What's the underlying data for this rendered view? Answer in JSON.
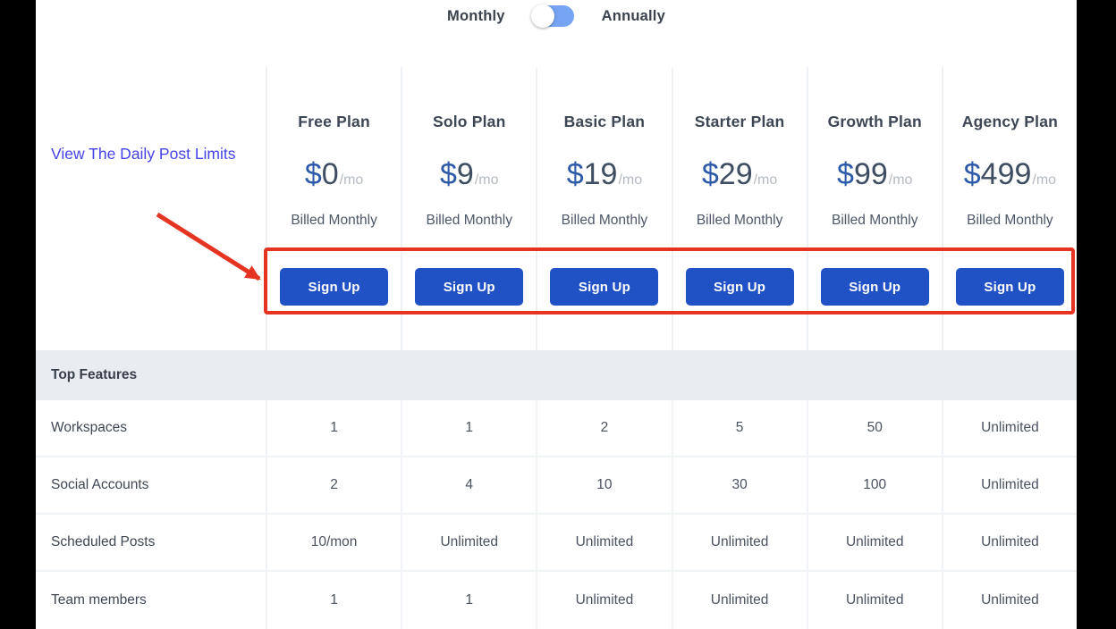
{
  "billing_toggle": {
    "monthly_label": "Monthly",
    "annually_label": "Annually",
    "selected": "Monthly"
  },
  "post_limits_link": "View The Daily Post Limits",
  "plans": [
    {
      "name": "Free Plan",
      "currency": "$",
      "amount": "0",
      "period": "/mo",
      "billing": "Billed Monthly",
      "cta": "Sign Up"
    },
    {
      "name": "Solo Plan",
      "currency": "$",
      "amount": "9",
      "period": "/mo",
      "billing": "Billed Monthly",
      "cta": "Sign Up"
    },
    {
      "name": "Basic Plan",
      "currency": "$",
      "amount": "19",
      "period": "/mo",
      "billing": "Billed Monthly",
      "cta": "Sign Up"
    },
    {
      "name": "Starter Plan",
      "currency": "$",
      "amount": "29",
      "period": "/mo",
      "billing": "Billed Monthly",
      "cta": "Sign Up"
    },
    {
      "name": "Growth Plan",
      "currency": "$",
      "amount": "99",
      "period": "/mo",
      "billing": "Billed Monthly",
      "cta": "Sign Up"
    },
    {
      "name": "Agency Plan",
      "currency": "$",
      "amount": "499",
      "period": "/mo",
      "billing": "Billed Monthly",
      "cta": "Sign Up"
    }
  ],
  "features": {
    "section_title": "Top Features",
    "rows": [
      {
        "label": "Workspaces",
        "values": [
          "1",
          "1",
          "2",
          "5",
          "50",
          "Unlimited"
        ]
      },
      {
        "label": "Social Accounts",
        "values": [
          "2",
          "4",
          "10",
          "30",
          "100",
          "Unlimited"
        ]
      },
      {
        "label": "Scheduled Posts",
        "values": [
          "10/mon",
          "Unlimited",
          "Unlimited",
          "Unlimited",
          "Unlimited",
          "Unlimited"
        ]
      },
      {
        "label": "Team members",
        "values": [
          "1",
          "1",
          "Unlimited",
          "Unlimited",
          "Unlimited",
          "Unlimited"
        ]
      }
    ]
  },
  "colors": {
    "signup_button_blue": "#2051c5",
    "toggle_track_blue": "#76a3f2",
    "annotation_red": "#e63422",
    "link_blue": "#4543e6",
    "price_dollar_blue": "#2c59a8",
    "section_header_bg": "#e9edf2",
    "letterbox_black": "#000000"
  }
}
